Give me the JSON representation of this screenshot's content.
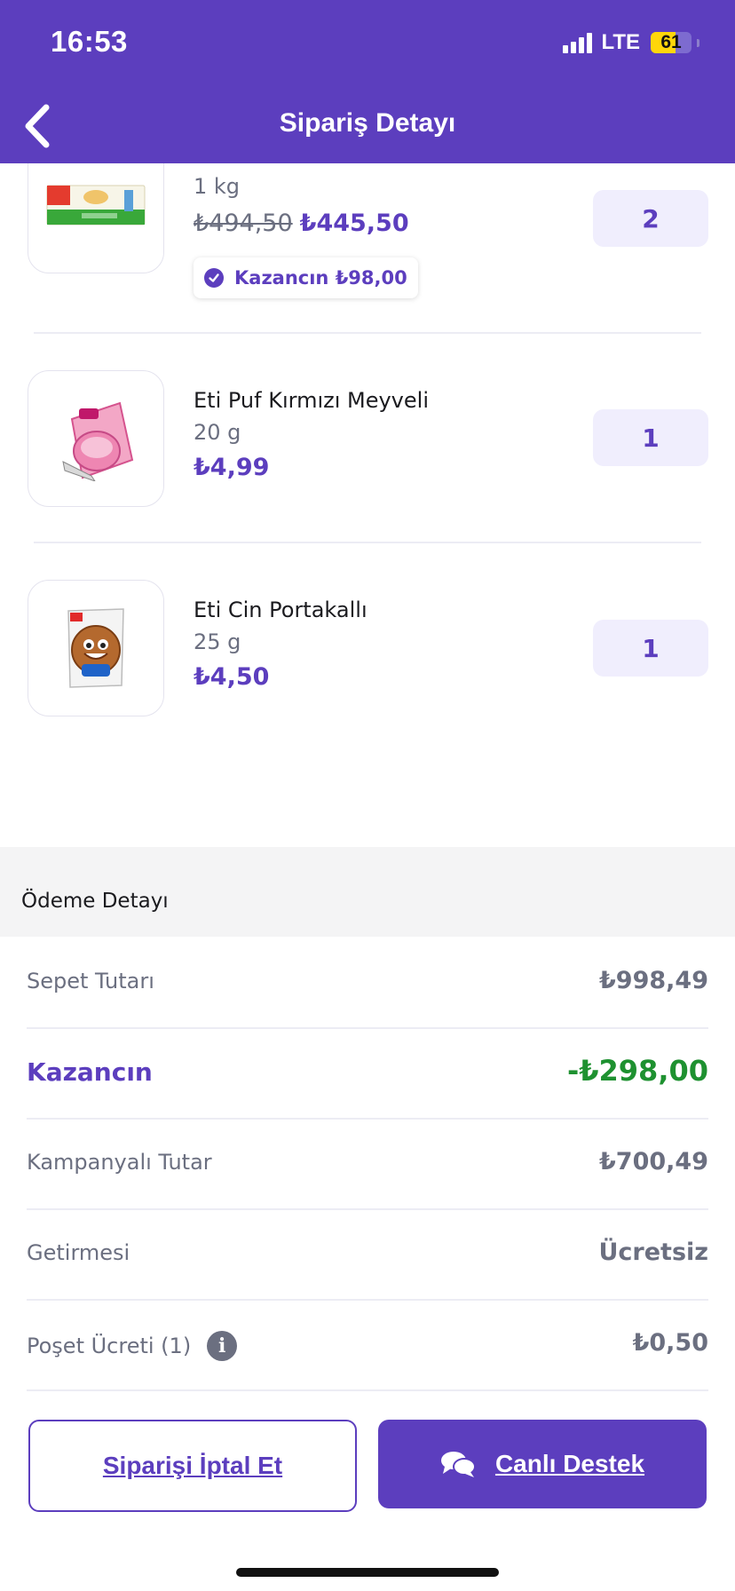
{
  "status_bar": {
    "time": "16:53",
    "network": "LTE",
    "battery": "61",
    "battery_level": 0.61
  },
  "nav": {
    "title": "Sipariş Detayı"
  },
  "colors": {
    "brand": "#5c3ebe",
    "discount": "#1e9130",
    "muted": "#6b6f80"
  },
  "products": [
    {
      "name": "",
      "weight": "1 kg",
      "old_price": "₺494,50",
      "price": "₺445,50",
      "quantity": "2",
      "savings": "Kazancın ₺98,00",
      "image": "milk-box"
    },
    {
      "name": "Eti Puf Kırmızı Meyveli",
      "weight": "20 g",
      "price": "₺4,99",
      "quantity": "1",
      "image": "pink-puff"
    },
    {
      "name": "Eti Cin Portakallı",
      "weight": "25 g",
      "price": "₺4,50",
      "quantity": "1",
      "image": "cin-cookie"
    }
  ],
  "payment": {
    "header": "Ödeme Detayı",
    "rows": [
      {
        "label": "Sepet Tutarı",
        "value": "₺998,49"
      },
      {
        "label": "Kazancın",
        "value": "-₺298,00"
      },
      {
        "label": "Kampanyalı Tutar",
        "value": "₺700,49"
      },
      {
        "label": "Getirmesi",
        "value": "Ücretsiz"
      },
      {
        "label": "Poşet Ücreti (1)",
        "value": "₺0,50"
      }
    ]
  },
  "actions": {
    "cancel_label": "Siparişi İptal Et",
    "support_label": "Canlı Destek"
  }
}
